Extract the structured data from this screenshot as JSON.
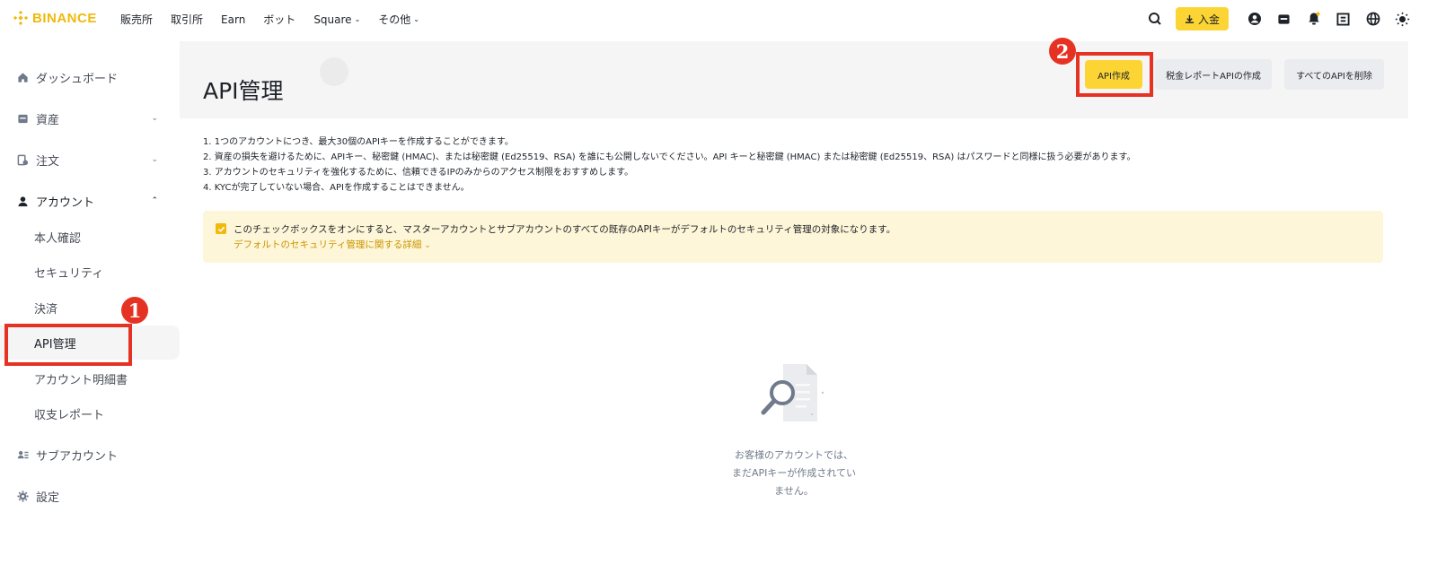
{
  "brand": {
    "name": "BINANCE",
    "color": "#f0b90b"
  },
  "nav": {
    "items": [
      {
        "label": "販売所",
        "dropdown": false
      },
      {
        "label": "取引所",
        "dropdown": false
      },
      {
        "label": "Earn",
        "dropdown": false
      },
      {
        "label": "ボット",
        "dropdown": false
      },
      {
        "label": "Square",
        "dropdown": true
      },
      {
        "label": "その他",
        "dropdown": true
      }
    ],
    "deposit_label": "入金",
    "icons": [
      "search-icon",
      "download-icon",
      "user-icon",
      "wallet-icon",
      "bell-icon",
      "qr-code-icon",
      "globe-icon",
      "theme-icon"
    ]
  },
  "sidebar": {
    "items": [
      {
        "label": "ダッシュボード",
        "icon": "home-icon"
      },
      {
        "label": "資産",
        "icon": "wallet-icon",
        "chevron": "down"
      },
      {
        "label": "注文",
        "icon": "orders-icon",
        "chevron": "down"
      },
      {
        "label": "アカウント",
        "icon": "user-icon",
        "chevron": "up"
      },
      {
        "label": "サブアカウント",
        "icon": "sub-account-icon"
      },
      {
        "label": "設定",
        "icon": "gear-icon"
      }
    ],
    "sub_items": [
      {
        "label": "本人確認"
      },
      {
        "label": "セキュリティ"
      },
      {
        "label": "決済"
      },
      {
        "label": "API管理",
        "active": true
      },
      {
        "label": "アカウント明細書"
      },
      {
        "label": "収支レポート"
      }
    ]
  },
  "main": {
    "title": "API管理",
    "buttons": {
      "create_api": "API作成",
      "tax_report_api": "税金レポートAPIの作成",
      "delete_all": "すべてのAPIを削除"
    },
    "notes": [
      "1. 1つのアカウントにつき、最大30個のAPIキーを作成することができます。",
      "2. 資産の損失を避けるために、APIキー、秘密鍵 (HMAC)、または秘密鍵 (Ed25519、RSA) を誰にも公開しないでください。API キーと秘密鍵 (HMAC) または秘密鍵 (Ed25519、RSA) はパスワードと同様に扱う必要があります。",
      "3. アカウントのセキュリティを強化するために、信頼できるIPのみからのアクセス制限をおすすめします。",
      "4. KYCが完了していない場合、APIを作成することはできません。"
    ],
    "alert": {
      "checked": true,
      "message": "このチェックボックスをオンにすると、マスターアカウントとサブアカウントのすべての既存のAPIキーがデフォルトのセキュリティ管理の対象になります。",
      "link": "デフォルトのセキュリティ管理に関する詳細"
    },
    "empty_state": {
      "lines": [
        "お客様のアカウントでは、",
        "まだAPIキーが作成されてい",
        "ません。"
      ]
    }
  },
  "annotations": {
    "badge_1": "1",
    "badge_2": "2",
    "color": "#e63223"
  },
  "colors": {
    "accent": "#fcd535",
    "alert_bg": "#fef6d8",
    "link": "#c99400"
  }
}
